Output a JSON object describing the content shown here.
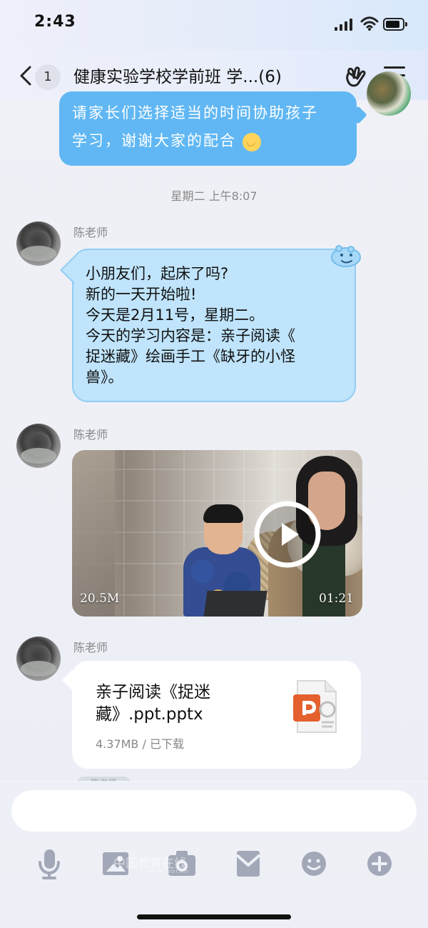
{
  "status": {
    "time": "2:43"
  },
  "chat": {
    "back_count": "1",
    "title": "健康实验学校学前班 学...(6)"
  },
  "messages": {
    "self_previous": {
      "line_1": "请家长们选择适当的时间协助孩子",
      "line_2": "学习，谢谢大家的配合",
      "emoji": "smiling-face"
    },
    "timestamp": "星期二 上午8:07",
    "teacher_text": {
      "sender": "陈老师",
      "lines": [
        "小朋友们，起床了吗?",
        "新的一天开始啦!",
        "今天是2月11号，星期二。",
        "今天的学习内容是：亲子阅读《",
        "捉迷藏》绘画手工《缺牙的小怪",
        "兽》。"
      ]
    },
    "teacher_video": {
      "sender": "陈老师",
      "size": "20.5M",
      "duration": "01:21"
    },
    "teacher_file": {
      "sender": "陈老师",
      "file_name_lines": [
        "亲子阅读《捉迷",
        "藏》.ppt.pptx"
      ],
      "meta": "4.37MB / 已下载",
      "icon": "powerpoint-icon"
    },
    "partial_label": "陈老师"
  },
  "composer": {
    "value": "",
    "tools": [
      "microphone-icon",
      "image-icon",
      "camera-icon",
      "red-packet-icon",
      "emoji-icon",
      "plus-icon"
    ]
  },
  "watermark": {
    "main": "中国教育在线",
    "sub": "www.eol.cn"
  },
  "colors": {
    "self_bubble": "#60b7f3",
    "teacher_bubble": "#bfe4fb",
    "background": "#eeeff5"
  }
}
